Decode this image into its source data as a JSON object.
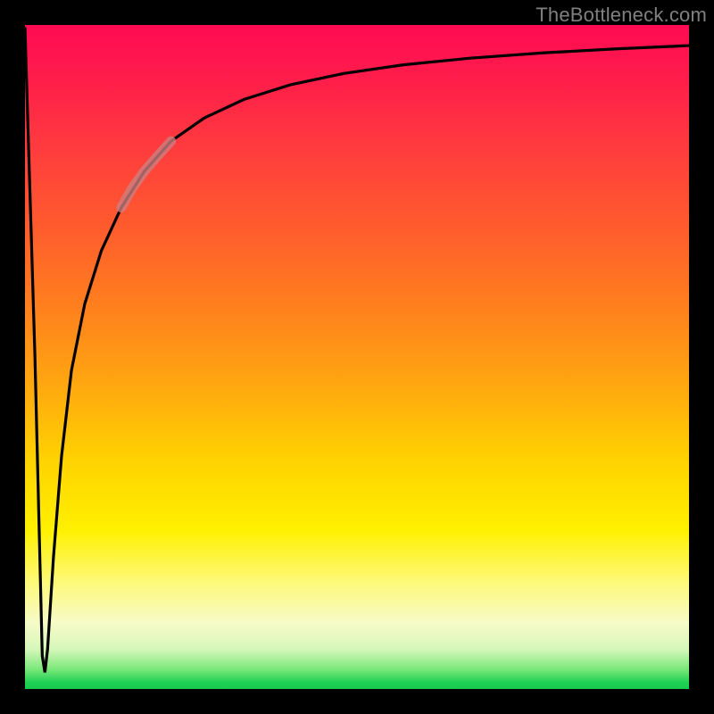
{
  "watermark": "TheBottleneck.com",
  "chart_data": {
    "type": "line",
    "title": "",
    "xlabel": "",
    "ylabel": "",
    "xlim": [
      0,
      100
    ],
    "ylim": [
      0,
      100
    ],
    "grid": false,
    "series": [
      {
        "name": "bottleneck-curve",
        "x": [
          0.0,
          1.5,
          2.6,
          3.0,
          3.4,
          4.3,
          5.5,
          7.0,
          9.0,
          11.5,
          14.5,
          18.0,
          22.0,
          27.0,
          33.0,
          40.0,
          48.0,
          57.0,
          67.0,
          78.0,
          89.0,
          100.0
        ],
        "values": [
          99.5,
          50.0,
          5.0,
          2.5,
          6.0,
          20.0,
          35.0,
          48.0,
          58.0,
          66.0,
          72.5,
          78.0,
          82.5,
          86.0,
          88.8,
          91.0,
          92.7,
          94.0,
          95.0,
          95.8,
          96.4,
          96.9
        ]
      },
      {
        "name": "highlight-segment",
        "x": [
          14.5,
          16.2,
          18.0,
          20.0,
          22.0
        ],
        "values": [
          72.5,
          75.5,
          78.0,
          80.3,
          82.5
        ]
      }
    ],
    "annotations": []
  },
  "colors": {
    "curve": "#000000",
    "highlight": "#cd7f80",
    "background_top": "#ff0a52",
    "background_bottom": "#17c94d"
  }
}
